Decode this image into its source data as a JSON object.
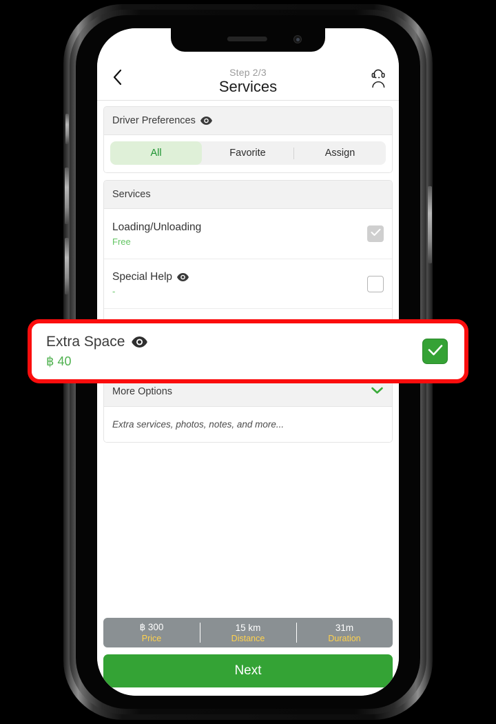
{
  "header": {
    "step_label": "Step 2/3",
    "title": "Services",
    "back_icon": "chevron-left-icon",
    "support_icon": "support-agent-icon"
  },
  "driver_preferences": {
    "section_title": "Driver Preferences",
    "info_icon": "eye-icon",
    "tabs": [
      {
        "label": "All",
        "active": true
      },
      {
        "label": "Favorite",
        "active": false
      },
      {
        "label": "Assign",
        "active": false
      }
    ]
  },
  "services": {
    "section_title": "Services",
    "items": [
      {
        "name": "Loading/Unloading",
        "price": "Free",
        "checkbox": "checked-disabled",
        "has_info_icon": false
      },
      {
        "name": "Special Help",
        "price": "-",
        "checkbox": "empty",
        "has_info_icon": true
      }
    ]
  },
  "highlighted_row": {
    "name": "Extra Space",
    "price": "฿ 40",
    "info_icon": "eye-icon",
    "checkbox": "checked",
    "highlight_color": "#fb0d0d",
    "check_color": "#35a235"
  },
  "more_options": {
    "section_title": "More Options",
    "chevron_icon": "chevron-down-icon",
    "body_text": "Extra services, photos, notes, and more..."
  },
  "summary": [
    {
      "value": "฿ 300",
      "label": "Price"
    },
    {
      "value": "15 km",
      "label": "Distance"
    },
    {
      "value": "31m",
      "label": "Duration"
    }
  ],
  "next_button": {
    "label": "Next",
    "color": "#34a335"
  }
}
